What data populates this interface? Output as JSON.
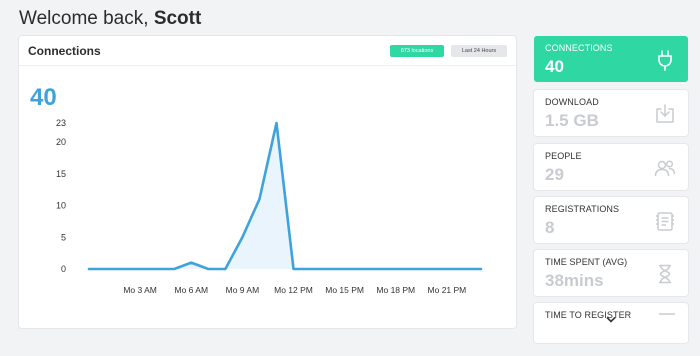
{
  "header": {
    "greeting": "Welcome back,",
    "user": "Scott"
  },
  "connections_card": {
    "title": "Connections",
    "badge_locations": "873 locations",
    "badge_range": "Last 24 Hours",
    "total": "40"
  },
  "chart_data": {
    "type": "area",
    "title": "",
    "xlabel": "",
    "ylabel": "",
    "ylim": [
      0,
      23
    ],
    "yticks": [
      0,
      5,
      10,
      15,
      20,
      23
    ],
    "x_tick_labels": [
      "Mo 3 AM",
      "Mo 6 AM",
      "Mo 9 AM",
      "Mo 12 PM",
      "Mo 15 PM",
      "Mo 18 PM",
      "Mo 21 PM"
    ],
    "x_tick_hours": [
      3,
      6,
      9,
      12,
      15,
      18,
      21
    ],
    "x_hours": [
      0,
      1,
      2,
      3,
      4,
      5,
      6,
      7,
      8,
      9,
      10,
      11,
      12,
      13,
      14,
      15,
      16,
      17,
      18,
      19,
      20,
      21,
      22,
      23
    ],
    "values": [
      0,
      0,
      0,
      0,
      0,
      0,
      1,
      0,
      0,
      5,
      11,
      23,
      0,
      0,
      0,
      0,
      0,
      0,
      0,
      0,
      0,
      0,
      0,
      0
    ],
    "color": "#3ea3dd",
    "fill_color": "#eaf4fc",
    "grid": false
  },
  "stats": [
    {
      "label": "Connections",
      "value": "40",
      "icon": "plug-icon",
      "active": true
    },
    {
      "label": "Download",
      "value": "1.5 GB",
      "icon": "download-icon",
      "active": false
    },
    {
      "label": "People",
      "value": "29",
      "icon": "people-icon",
      "active": false
    },
    {
      "label": "Registrations",
      "value": "8",
      "icon": "registration-icon",
      "active": false
    },
    {
      "label": "Time spent (avg)",
      "value": "38mins",
      "icon": "hourglass-icon",
      "active": false
    },
    {
      "label": "Time to register",
      "value": "",
      "icon": "chevron-down-icon",
      "active": false
    }
  ],
  "colors": {
    "accent_green": "#2fd8a3",
    "accent_blue": "#3ea3dd",
    "muted_value": "#c8cbd0"
  }
}
